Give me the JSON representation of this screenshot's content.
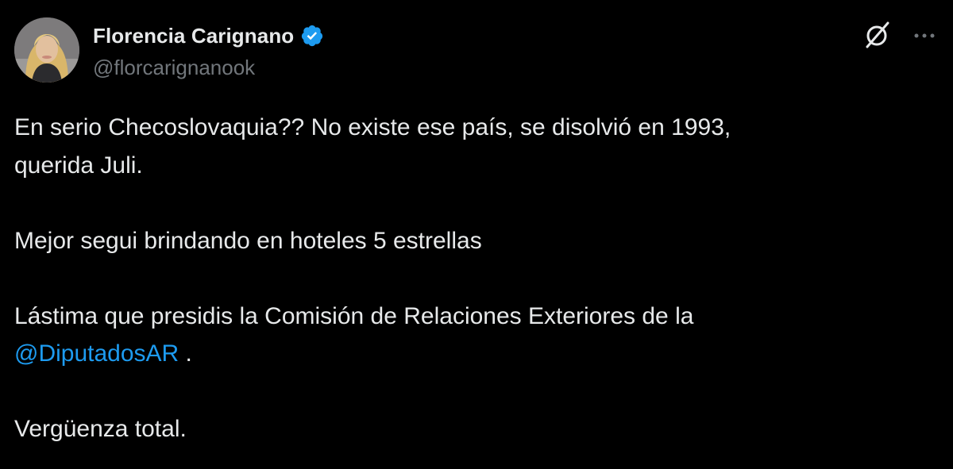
{
  "author": {
    "display_name": "Florencia Carignano",
    "handle": "@florcarignanook",
    "verified_icon": "verified-badge-icon",
    "avatar_icon": "avatar-photo"
  },
  "actions": {
    "grok_icon": "grok-icon",
    "more_icon": "more-options-icon"
  },
  "tweet": {
    "line1": "En serio Checoslovaquia?? No existe ese país, se disolvió en 1993,",
    "line2": "querida Juli.",
    "line3": "Mejor segui brindando en hoteles 5 estrellas",
    "line4": "Lástima que presidis la Comisión de Relaciones Exteriores de la",
    "mention": "@DiputadosAR",
    "after_mention": " .",
    "line6": "Vergüenza total."
  },
  "colors": {
    "background": "#000000",
    "text": "#e7e9ea",
    "secondary_text": "#71767b",
    "link": "#1d9bf0",
    "verified": "#1d9bf0"
  }
}
